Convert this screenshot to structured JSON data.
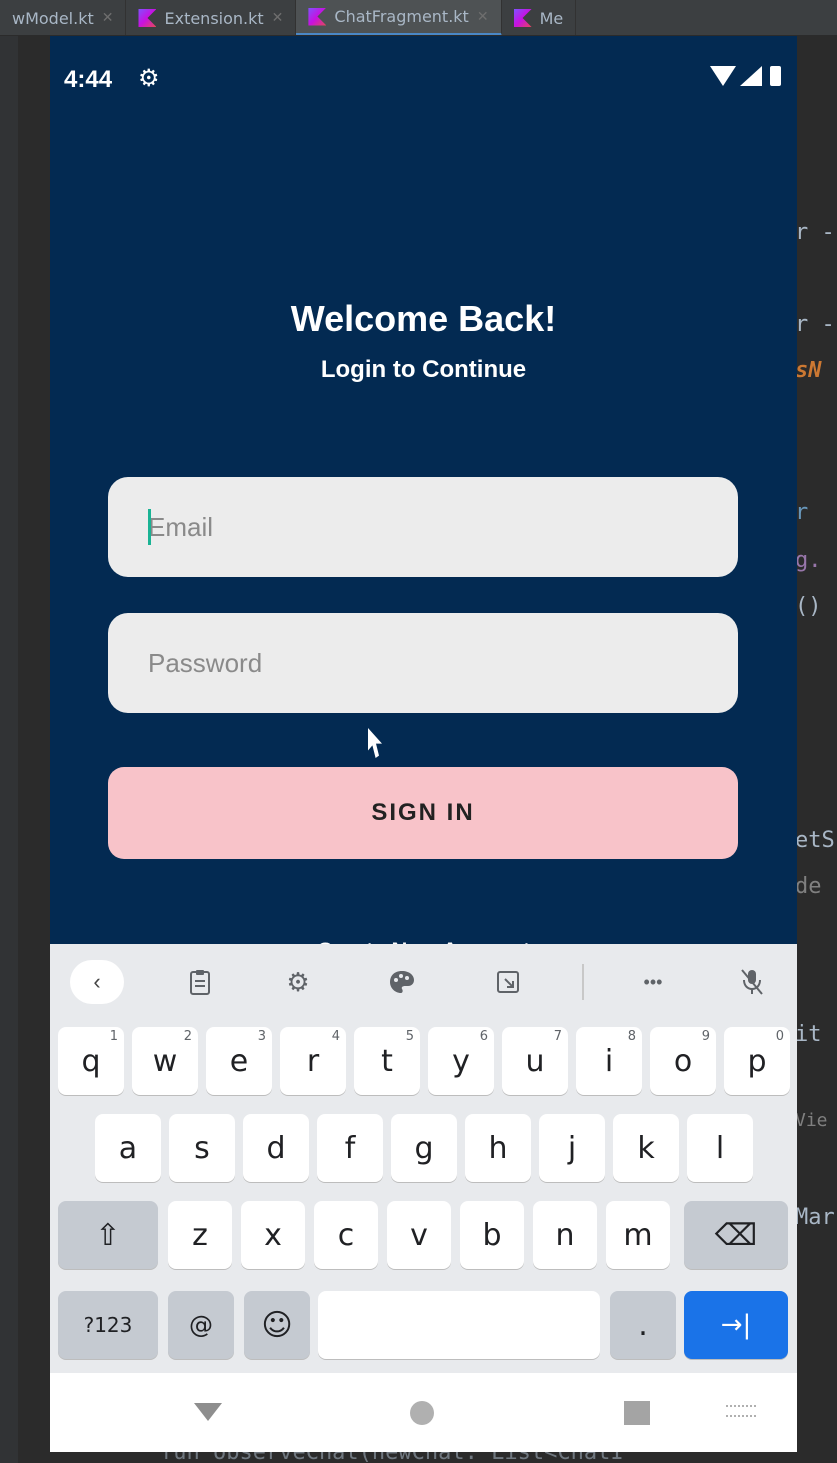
{
  "ide": {
    "tabs": [
      {
        "label": "wModel.kt",
        "active": false
      },
      {
        "label": "Extension.kt",
        "active": false
      },
      {
        "label": "ChatFragment.kt",
        "active": true
      },
      {
        "label": "Me",
        "active": false
      }
    ],
    "code_fragments": [
      "r -",
      "r -",
      "sN",
      "r",
      "g.",
      "()",
      "etS",
      "de",
      "it",
      "Vie",
      "Mar"
    ],
    "bottom_code": "fun observeChat(newChat: List<ChatI"
  },
  "status_bar": {
    "time": "4:44",
    "gear_icon": "gear-icon",
    "wifi_icon": "wifi-icon",
    "signal_icon": "signal-icon",
    "battery_icon": "battery-icon"
  },
  "login": {
    "title": "Welcome Back!",
    "subtitle": "Login to Continue",
    "email_placeholder": "Email",
    "email_value": "",
    "password_placeholder": "Password",
    "password_value": "",
    "sign_in_label": "SIGN IN",
    "create_account_peek": "Create New Account"
  },
  "keyboard": {
    "toolbar": [
      "back-icon",
      "clipboard-icon",
      "settings-icon",
      "palette-icon",
      "screenshot-icon",
      "more-icon",
      "mic-off-icon"
    ],
    "more_label": "•••",
    "row1": [
      {
        "key": "q",
        "hint": "1"
      },
      {
        "key": "w",
        "hint": "2"
      },
      {
        "key": "e",
        "hint": "3"
      },
      {
        "key": "r",
        "hint": "4"
      },
      {
        "key": "t",
        "hint": "5"
      },
      {
        "key": "y",
        "hint": "6"
      },
      {
        "key": "u",
        "hint": "7"
      },
      {
        "key": "i",
        "hint": "8"
      },
      {
        "key": "o",
        "hint": "9"
      },
      {
        "key": "p",
        "hint": "0"
      }
    ],
    "row2": [
      "a",
      "s",
      "d",
      "f",
      "g",
      "h",
      "j",
      "k",
      "l"
    ],
    "row3": [
      "z",
      "x",
      "c",
      "v",
      "b",
      "n",
      "m"
    ],
    "symbols_label": "?123",
    "at_label": "@",
    "emoji_label": "☺",
    "period_label": ".",
    "shift_label": "⇧",
    "backspace_label": "⌫",
    "next_label": "→|"
  },
  "colors": {
    "app_background": "#032a52",
    "sign_in_button": "#f8c3c9",
    "field_background": "#ececec",
    "keyboard_action": "#1a73e8"
  }
}
